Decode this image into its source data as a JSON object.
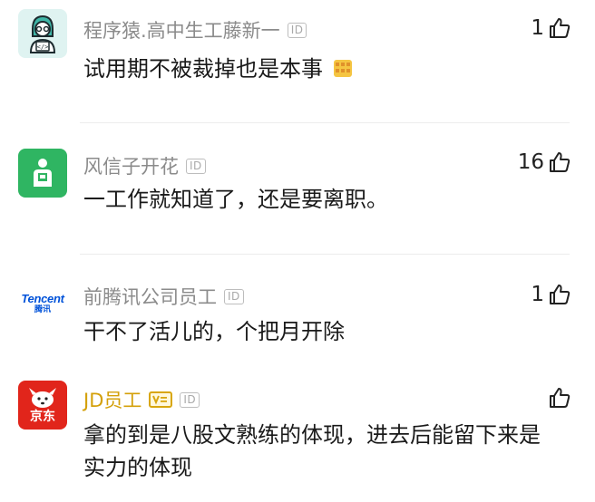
{
  "comments": [
    {
      "author": "程序猿.高中生工藤新一",
      "id_badge": "ID",
      "likes": "1",
      "text": "试用期不被裁掉也是本事",
      "emoji": "party-emoji"
    },
    {
      "author": "风信子开花",
      "id_badge": "ID",
      "likes": "16",
      "text": "一工作就知道了，还是要离职。"
    },
    {
      "author": "前腾讯公司员工",
      "id_badge": "ID",
      "likes": "1",
      "text": "干不了活儿的，个把月开除",
      "avatar_text_en": "Tencent",
      "avatar_text_cn": "腾讯"
    },
    {
      "author": "JD员工",
      "id_badge": "ID",
      "likes": "",
      "text_line1": "拿的到是八股文熟练的体现，进去后能留下来是",
      "text_line2": "实力的体现",
      "avatar_text_cn": "京东"
    }
  ],
  "colors": {
    "avatar_teal": "#dff3f1",
    "avatar_green": "#2fb562",
    "jd_red": "#e1251b",
    "vip_gold": "#d4a00a"
  }
}
